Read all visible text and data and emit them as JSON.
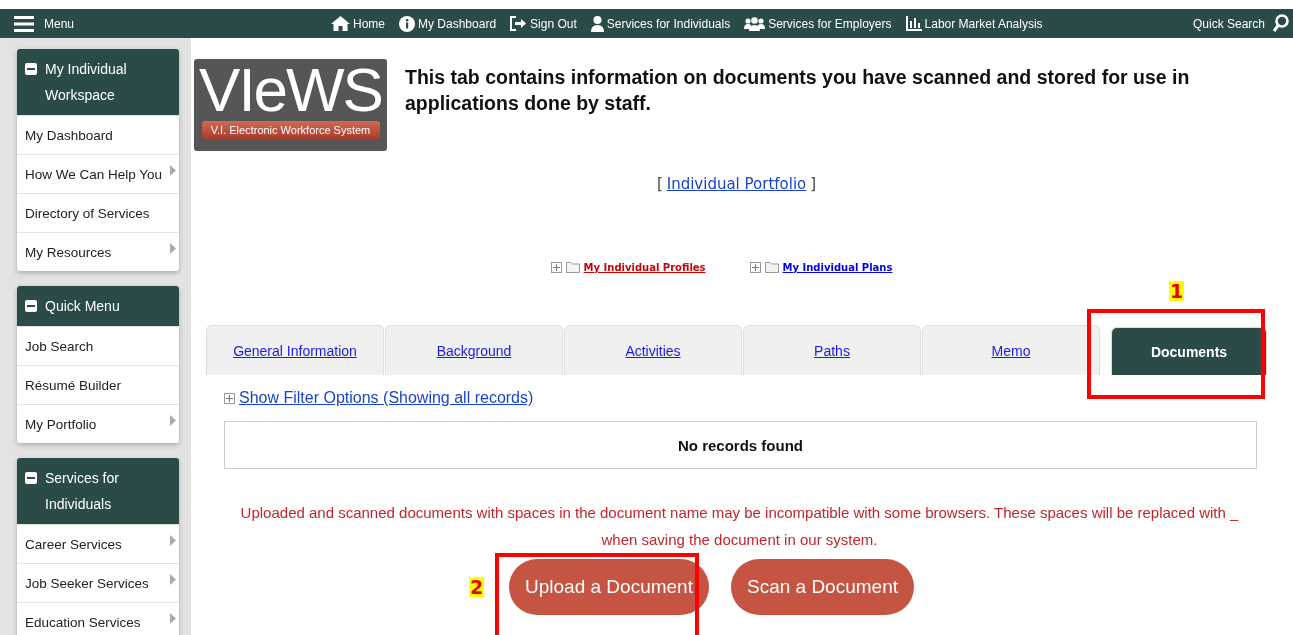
{
  "topbar": {
    "menu_label": "Menu",
    "nav": [
      {
        "label": "Home"
      },
      {
        "label": "My Dashboard"
      },
      {
        "label": "Sign Out"
      },
      {
        "label": "Services for Individuals"
      },
      {
        "label": "Services for Employers"
      },
      {
        "label": "Labor Market Analysis"
      }
    ],
    "quick_search": "Quick Search"
  },
  "sidebar": {
    "panels": [
      {
        "title": "My Individual Workspace",
        "items": [
          {
            "label": "My Dashboard",
            "submenu": false
          },
          {
            "label": "How We Can Help You",
            "submenu": true
          },
          {
            "label": "Directory of Services",
            "submenu": false
          },
          {
            "label": "My Resources",
            "submenu": true
          }
        ]
      },
      {
        "title": "Quick Menu",
        "items": [
          {
            "label": "Job Search",
            "submenu": false
          },
          {
            "label": "Résumé Builder",
            "submenu": false
          },
          {
            "label": "My Portfolio",
            "submenu": true
          }
        ]
      },
      {
        "title": "Services for Individuals",
        "items": [
          {
            "label": "Career Services",
            "submenu": true
          },
          {
            "label": "Job Seeker Services",
            "submenu": true
          },
          {
            "label": "Education Services",
            "submenu": true
          }
        ]
      }
    ]
  },
  "logo": {
    "title": "VIeWS",
    "subtitle": "V.I. Electronic Workforce System"
  },
  "intro": "This tab contains information on documents you have scanned and stored for use in applications done by staff.",
  "portfolio": {
    "open": "[",
    "link": "Individual Portfolio",
    "close": "]"
  },
  "tree_links": [
    {
      "label": "My Individual Profiles",
      "color": "#cc0000"
    },
    {
      "label": "My Individual Plans",
      "color": "#0000ee"
    }
  ],
  "tabs": [
    {
      "label": "General Information",
      "selected": false
    },
    {
      "label": "Background",
      "selected": false
    },
    {
      "label": "Activities",
      "selected": false
    },
    {
      "label": "Paths",
      "selected": false
    },
    {
      "label": "Memo",
      "selected": false
    },
    {
      "label": "Documents",
      "selected": true,
      "callout": "1"
    }
  ],
  "filter_link": "Show Filter Options (Showing all records)",
  "table": {
    "empty_message": "No records found"
  },
  "notice": "Uploaded and scanned documents with spaces in the document name may be incompatible with some browsers. These spaces will be replaced with _ when saving the document in our system.",
  "buttons": [
    {
      "label": "Upload a Document",
      "callout": "2"
    },
    {
      "label": "Scan a Document"
    }
  ]
}
